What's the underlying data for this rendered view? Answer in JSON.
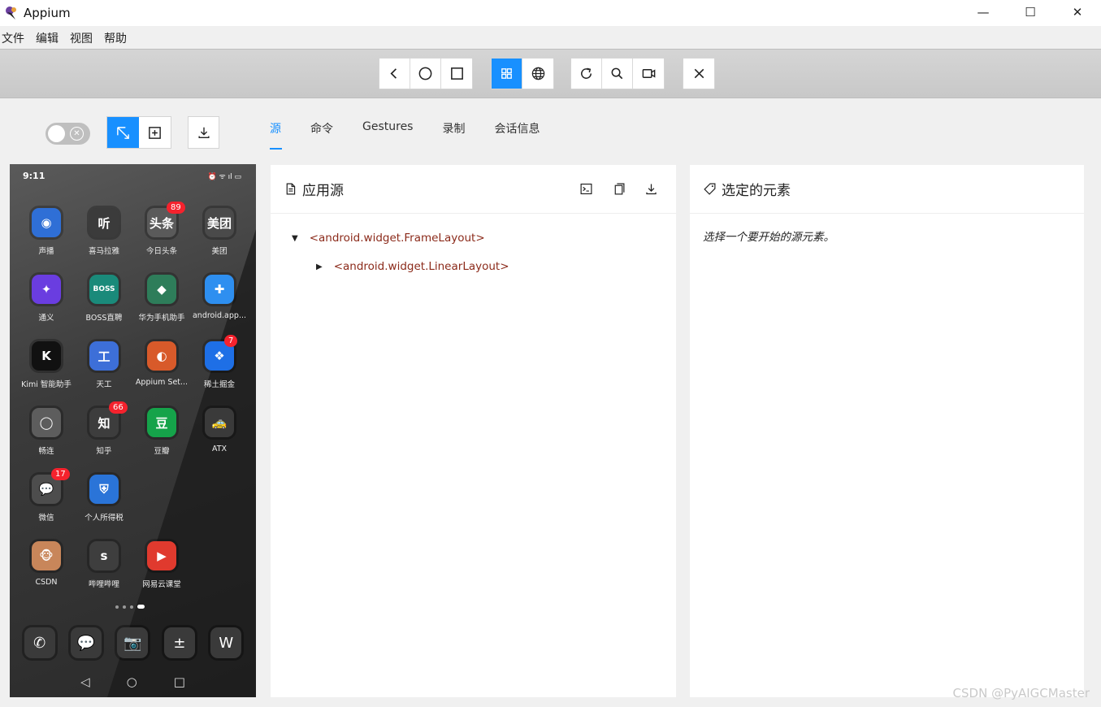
{
  "window": {
    "title": "Appium",
    "minimize": "—",
    "maximize": "☐",
    "close": "✕"
  },
  "menu": [
    "文件",
    "编辑",
    "视图",
    "帮助"
  ],
  "tabs": [
    "源",
    "命令",
    "Gestures",
    "录制",
    "会话信息"
  ],
  "phone": {
    "time": "9:11",
    "status_icons": "⏰ ᯤ ıl ▭",
    "apps": [
      {
        "label": "声播",
        "color": "#2f6fd6",
        "glyph": "◉"
      },
      {
        "label": "喜马拉雅",
        "color": "#3b3b3b",
        "glyph": "听"
      },
      {
        "label": "今日头条",
        "color": "#5a5a5a",
        "glyph": "头条",
        "badge": "89"
      },
      {
        "label": "美团",
        "color": "#4a4a4a",
        "glyph": "美团"
      },
      {
        "label": "通义",
        "color": "#6a3de0",
        "glyph": "✦"
      },
      {
        "label": "BOSS直聘",
        "color": "#1a8a7a",
        "glyph": "BOSS"
      },
      {
        "label": "华为手机助手",
        "color": "#2e7d5a",
        "glyph": "◆"
      },
      {
        "label": "android.app...",
        "color": "#2e8ff0",
        "glyph": "✚"
      },
      {
        "label": "Kimi 智能助手",
        "color": "#111111",
        "glyph": "K"
      },
      {
        "label": "天工",
        "color": "#3d6fd8",
        "glyph": "工"
      },
      {
        "label": "Appium Set...",
        "color": "#d85a2a",
        "glyph": "◐"
      },
      {
        "label": "稀土掘金",
        "color": "#1e6fe6",
        "glyph": "❖",
        "badge": "7"
      },
      {
        "label": "畅连",
        "color": "#5d5d5d",
        "glyph": "◯"
      },
      {
        "label": "知乎",
        "color": "#3d3d3d",
        "glyph": "知",
        "badge": "66"
      },
      {
        "label": "豆瓣",
        "color": "#15a34a",
        "glyph": "豆"
      },
      {
        "label": "ATX",
        "color": "#3a3a3a",
        "glyph": "🚕"
      },
      {
        "label": "微信",
        "color": "#4d4d4d",
        "glyph": "💬",
        "badge": "17"
      },
      {
        "label": "个人所得税",
        "color": "#2a74d8",
        "glyph": "⛨"
      },
      {
        "label": "CSDN",
        "color": "#c8865a",
        "glyph": "🐵"
      },
      {
        "label": "哔哩哔哩",
        "color": "#3e3e3e",
        "glyph": "ꜱ"
      },
      {
        "label": "网易云课堂",
        "color": "#e03a2e",
        "glyph": "▶"
      }
    ],
    "dock": [
      "✆",
      "💬",
      "📷",
      "±",
      "W"
    ],
    "nav": [
      "◁",
      "○",
      "□"
    ]
  },
  "source_panel": {
    "title": "应用源",
    "nodes": [
      "<android.widget.FrameLayout>",
      "<android.widget.LinearLayout>"
    ]
  },
  "selected_panel": {
    "title": "选定的元素",
    "hint": "选择一个要开始的源元素。"
  },
  "watermark": "CSDN @PyAIGCMaster"
}
